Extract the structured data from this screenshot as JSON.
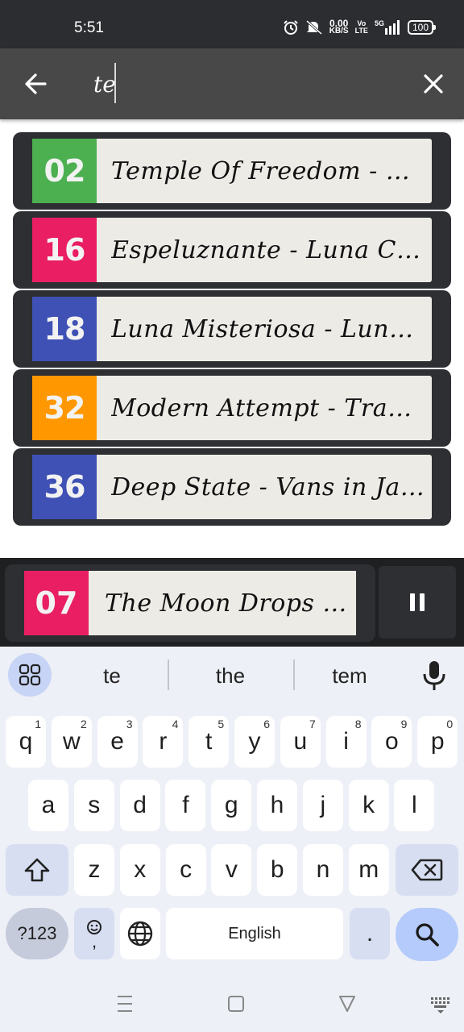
{
  "status_bar": {
    "time": "5:51",
    "net_speed_value": "0.00",
    "net_speed_unit": "KB/S",
    "volte_top": "Vo",
    "volte_bottom": "LTE",
    "network_type": "5G",
    "battery": "100",
    "icons": [
      "alarm-icon",
      "mute-icon",
      "signal-icon",
      "battery-icon"
    ]
  },
  "search": {
    "value": "te",
    "icons": [
      "back-arrow-icon",
      "close-icon"
    ]
  },
  "results": [
    {
      "number": "02",
      "title": "Temple Of Freedom - Hanu ...",
      "color": "#4caf50"
    },
    {
      "number": "16",
      "title": "Espeluznante - Luna Cantina",
      "color": "#e91e63"
    },
    {
      "number": "18",
      "title": "Luna Misteriosa - Luna Ca...",
      "color": "#3f51b5"
    },
    {
      "number": "32",
      "title": "Modern Attempt - TrackTri...",
      "color": "#ff9800"
    },
    {
      "number": "36",
      "title": "Deep State - Vans in Japan",
      "color": "#3f51b5"
    }
  ],
  "now_playing": {
    "number": "07",
    "title": "The Moon Drops - N...",
    "color": "#e91e63",
    "icon": "pause-icon"
  },
  "keyboard": {
    "suggestions": [
      "te",
      "the",
      "tem"
    ],
    "row1": [
      {
        "key": "q",
        "hint": "1"
      },
      {
        "key": "w",
        "hint": "2"
      },
      {
        "key": "e",
        "hint": "3"
      },
      {
        "key": "r",
        "hint": "4"
      },
      {
        "key": "t",
        "hint": "5"
      },
      {
        "key": "y",
        "hint": "6"
      },
      {
        "key": "u",
        "hint": "7"
      },
      {
        "key": "i",
        "hint": "8"
      },
      {
        "key": "o",
        "hint": "9"
      },
      {
        "key": "p",
        "hint": "0"
      }
    ],
    "row2": [
      "a",
      "s",
      "d",
      "f",
      "g",
      "h",
      "j",
      "k",
      "l"
    ],
    "row3": [
      "z",
      "x",
      "c",
      "v",
      "b",
      "n",
      "m"
    ],
    "symbols_label": "?123",
    "emoji_comma": ",",
    "space_label": "English",
    "period": ".",
    "icons": [
      "apps-grid-icon",
      "mic-icon",
      "shift-icon",
      "backspace-icon",
      "emoji-icon",
      "globe-icon",
      "search-icon"
    ]
  },
  "nav_bar": {
    "icons": [
      "recents-icon",
      "home-icon",
      "back-icon",
      "keyboard-switch-icon"
    ]
  },
  "colors": {
    "header": "#484848",
    "row_bg": "#2e2f33",
    "title_bg": "#ecebe6",
    "keyboard_bg": "#eef0f7",
    "accent_key": "#b5cbfb"
  }
}
